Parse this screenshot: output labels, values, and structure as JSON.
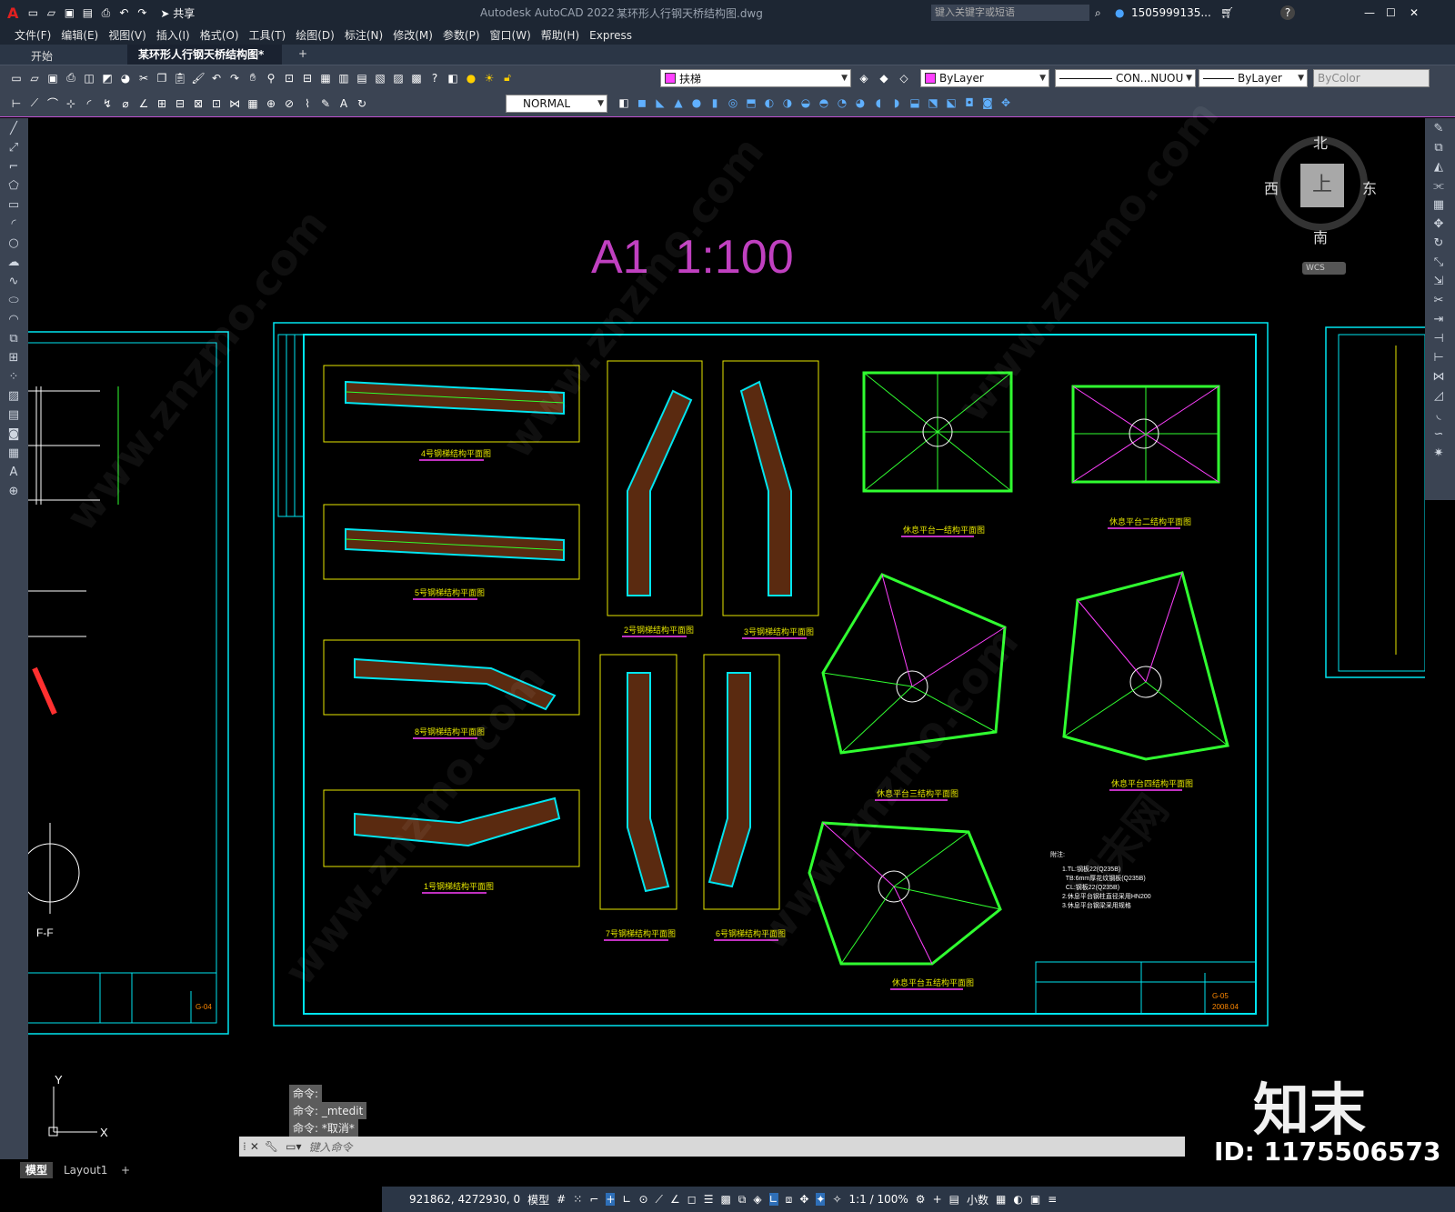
{
  "titlebar": {
    "app_title": "Autodesk AutoCAD 2022",
    "file_name": "某环形人行钢天桥结构图.dwg",
    "share_label": "共享",
    "search_placeholder": "键入关键字或短语",
    "user": "1505999135...",
    "help": "?"
  },
  "menu": [
    "文件(F)",
    "编辑(E)",
    "视图(V)",
    "插入(I)",
    "格式(O)",
    "工具(T)",
    "绘图(D)",
    "标注(N)",
    "修改(M)",
    "参数(P)",
    "窗口(W)",
    "帮助(H)",
    "Express"
  ],
  "tabs": [
    {
      "label": "开始"
    },
    {
      "label": "某环形人行钢天桥结构图*"
    }
  ],
  "toolbar": {
    "layer": "扶梯",
    "color": "ByLayer",
    "linetype": "CON...NUOU",
    "lineweight": "ByLayer",
    "plotstyle": "ByColor",
    "dimstyle": "NORMAL"
  },
  "viewcube": {
    "north": "北",
    "south": "南",
    "east": "东",
    "west": "西",
    "top": "上",
    "wcs": "WCS"
  },
  "drawing": {
    "scale_title": "A1  1:100",
    "plans": [
      "4号钢梯结构平面图",
      "5号钢梯结构平面图",
      "8号钢梯结构平面图",
      "1号钢梯结构平面图",
      "2号钢梯结构平面图",
      "3号钢梯结构平面图",
      "7号钢梯结构平面图",
      "6号钢梯结构平面图",
      "休息平台一结构平面图",
      "休息平台二结构平面图",
      "休息平台三结构平面图",
      "休息平台四结构平面图",
      "休息平台五结构平面图"
    ],
    "left_section": "F-F",
    "notes_title": "附注:",
    "notes": [
      "1.TL:钢板22(Q235B)",
      "  TB:6mm厚花纹钢板(Q235B)",
      "  CL:钢板22(Q235B)",
      "2.休息平台钢柱直径采用HN200",
      "3.休息平台钢梁采用规格"
    ],
    "sheet_no_right": "G-05",
    "sheet_no_left": "G-04",
    "date": "2008.04"
  },
  "command": {
    "history": [
      "命令:",
      "命令: _mtedit",
      "命令: *取消*"
    ],
    "placeholder": "键入命令"
  },
  "layout_tabs": [
    "模型",
    "Layout1"
  ],
  "status": {
    "coords": "921862, 4272930, 0",
    "mode": "模型",
    "scale": "1:1 / 100%",
    "units": "小数"
  },
  "watermark": {
    "brand": "知末",
    "id": "ID: 1175506573",
    "site": "www.znzmo.com",
    "site_cn": "知末网"
  },
  "colors": {
    "cyan": "#00e5f0",
    "yellow": "#e6e600",
    "magenta": "#ff40ff",
    "green": "#30ff30",
    "orange": "#e07020",
    "bg": "#000000"
  }
}
